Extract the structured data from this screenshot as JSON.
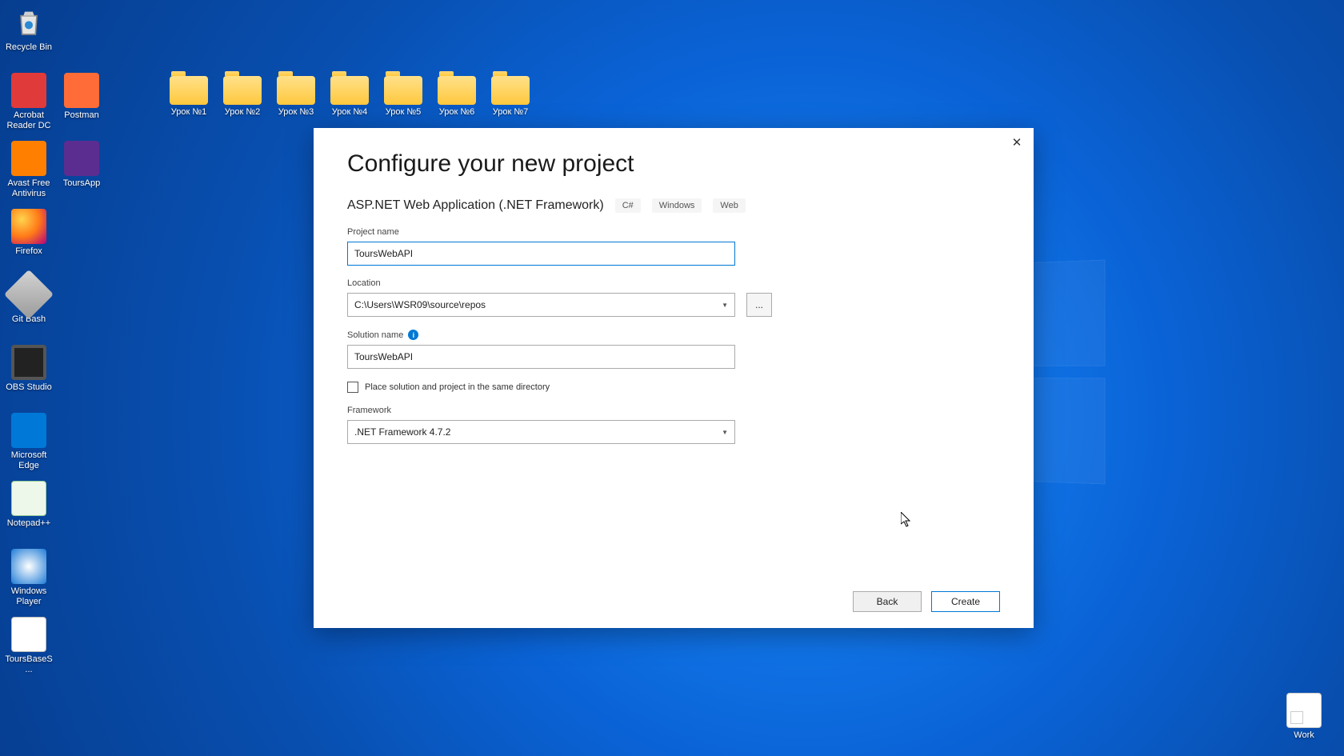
{
  "desktop": {
    "left_icons": [
      {
        "label": "Recycle Bin",
        "kind": "recycle"
      },
      {
        "label": "Acrobat Reader DC",
        "kind": "acrobat"
      },
      {
        "label": "Avast Free Antivirus",
        "kind": "avast"
      },
      {
        "label": "Firefox",
        "kind": "firefox"
      },
      {
        "label": "Git Bash",
        "kind": "gitbash"
      },
      {
        "label": "OBS Studio",
        "kind": "obs"
      },
      {
        "label": "Microsoft Edge",
        "kind": "edge"
      },
      {
        "label": "Notepad++",
        "kind": "npp"
      },
      {
        "label": "Windows Player",
        "kind": "wmp"
      },
      {
        "label": "ToursBaseS...",
        "kind": "sql"
      }
    ],
    "left2_icons": [
      {
        "label": "Postman",
        "kind": "postman"
      },
      {
        "label": "ToursApp",
        "kind": "vs"
      }
    ],
    "folder_icons": [
      {
        "label": "Урок №1"
      },
      {
        "label": "Урок №2"
      },
      {
        "label": "Урок №3"
      },
      {
        "label": "Урок №4"
      },
      {
        "label": "Урок №5"
      },
      {
        "label": "Урок №6"
      },
      {
        "label": "Урок №7"
      }
    ],
    "right_icon": {
      "label": "Work",
      "kind": "doc"
    }
  },
  "dialog": {
    "title": "Configure your new project",
    "subtitle": "ASP.NET Web Application (.NET Framework)",
    "tags": [
      "C#",
      "Windows",
      "Web"
    ],
    "project_name_label": "Project name",
    "project_name_value": "ToursWebAPI",
    "location_label": "Location",
    "location_value": "C:\\Users\\WSR09\\source\\repos",
    "browse_label": "...",
    "solution_name_label": "Solution name",
    "info_badge": "i",
    "solution_name_value": "ToursWebAPI",
    "same_dir_label": "Place solution and project in the same directory",
    "same_dir_checked": false,
    "framework_label": "Framework",
    "framework_value": ".NET Framework 4.7.2",
    "back_label": "Back",
    "create_label": "Create",
    "close_glyph": "✕"
  }
}
